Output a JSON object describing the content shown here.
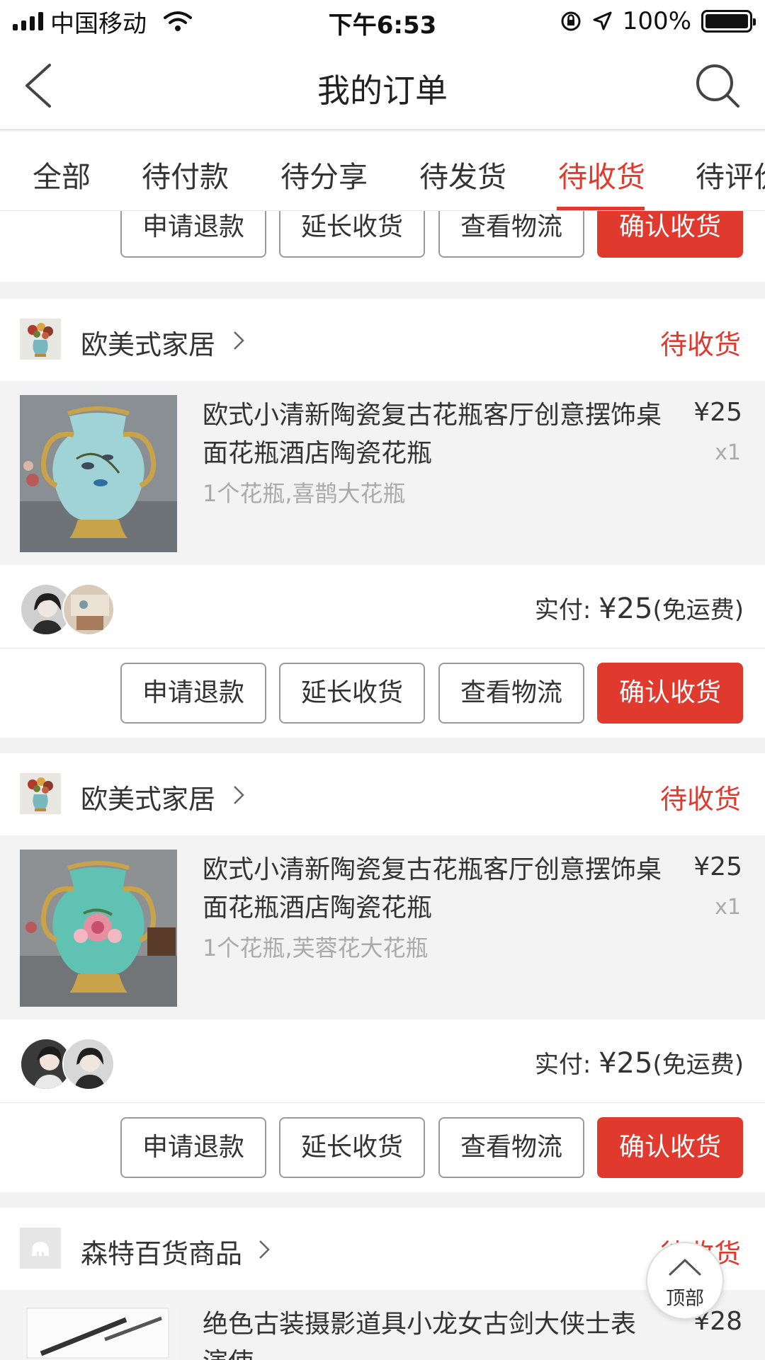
{
  "status_bar": {
    "carrier": "中国移动",
    "time": "下午6:53",
    "battery": "100%",
    "battery_level": 1.0
  },
  "nav": {
    "title": "我的订单",
    "back_icon": "chevron-left-icon",
    "search_icon": "search-icon"
  },
  "tabs": [
    {
      "label": "全部"
    },
    {
      "label": "待付款"
    },
    {
      "label": "待分享"
    },
    {
      "label": "待发货"
    },
    {
      "label": "待收货",
      "active": true
    },
    {
      "label": "待评价"
    }
  ],
  "buttons": {
    "refund": "申请退款",
    "extend": "延长收货",
    "logistics": "查看物流",
    "confirm": "确认收货"
  },
  "orders": [
    {
      "shop": "欧美式家居",
      "status": "待收货",
      "title": "欧式小清新陶瓷复古花瓶客厅创意摆饰桌面花瓶酒店陶瓷花瓶",
      "sku": "1个花瓶,喜鹊大花瓶",
      "price": "¥25",
      "qty": "x1",
      "pay_label": "实付:",
      "pay_amount": "¥25",
      "pay_note": "(免运费)"
    },
    {
      "shop": "欧美式家居",
      "status": "待收货",
      "title": "欧式小清新陶瓷复古花瓶客厅创意摆饰桌面花瓶酒店陶瓷花瓶",
      "sku": "1个花瓶,芙蓉花大花瓶",
      "price": "¥25",
      "qty": "x1",
      "pay_label": "实付:",
      "pay_amount": "¥25",
      "pay_note": "(免运费)"
    },
    {
      "shop": "森特百货商品",
      "status": "待收货",
      "title": "绝色古装摄影道具小龙女古剑大侠士表演使",
      "price": "¥28"
    }
  ],
  "back_to_top": "顶部",
  "colors": {
    "accent": "#e03a2f",
    "text": "#333333",
    "muted": "#aaaaaa",
    "background": "#f2f2f2"
  }
}
